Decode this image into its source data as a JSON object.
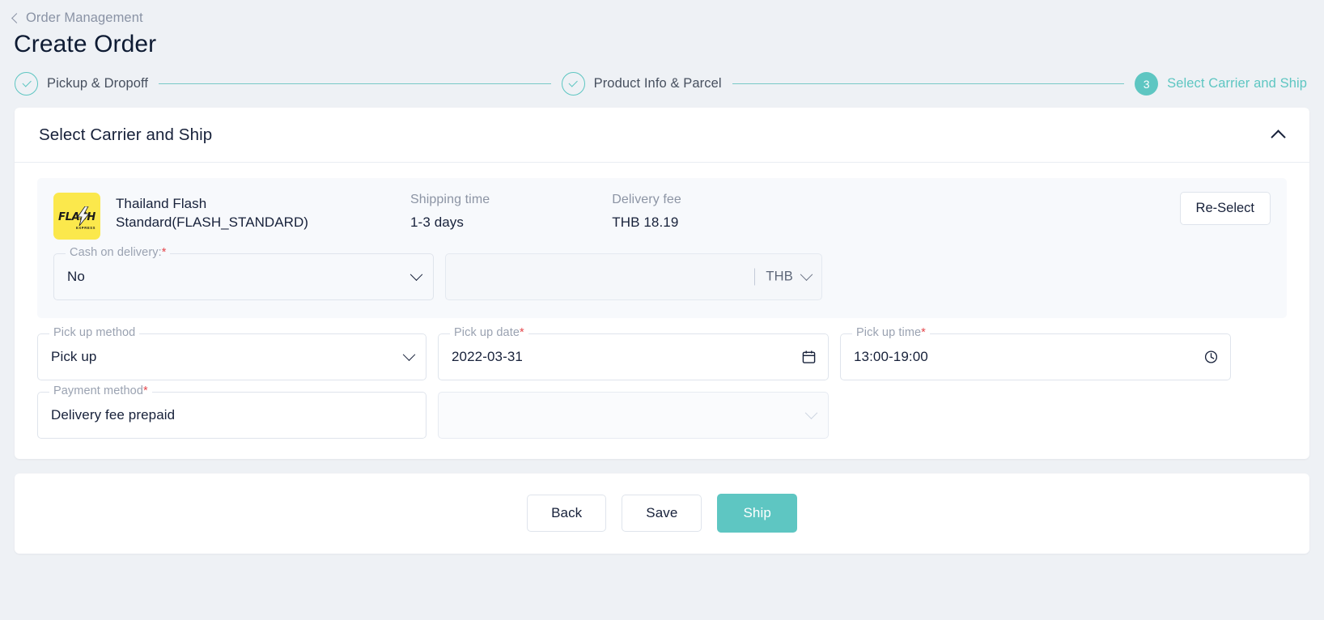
{
  "header": {
    "breadcrumb": "Order Management",
    "back_icon": "chevron-left-icon",
    "title": "Create Order"
  },
  "stepper": {
    "steps": [
      {
        "label": "Pickup & Dropoff",
        "state": "done",
        "marker": "check-icon"
      },
      {
        "label": "Product Info & Parcel",
        "state": "done",
        "marker": "check-icon"
      },
      {
        "label": "Select Carrier and Ship",
        "state": "active",
        "marker": "3"
      }
    ],
    "active_color": "#5ec6c2",
    "line_color": "#79c9c7"
  },
  "section": {
    "title": "Select Carrier and Ship",
    "collapse_icon": "chevron-up-icon"
  },
  "carrier": {
    "logo_text": "FLASH",
    "logo_sub": "EXPRESS",
    "logo_bg": "#fbe84c",
    "name": "Thailand Flash Standard(FLASH_STANDARD)",
    "shipping_time_label": "Shipping time",
    "shipping_time_value": "1-3 days",
    "delivery_fee_label": "Delivery fee",
    "delivery_fee_value": "THB 18.19",
    "reselect_label": "Re-Select"
  },
  "fields": {
    "cash_on_delivery": {
      "label": "Cash on delivery:",
      "required": "*",
      "value": "No",
      "icon": "chevron-down-icon"
    },
    "cod_amount": {
      "label": "",
      "value": "",
      "placeholder": "",
      "currency": "THB",
      "currency_icon": "chevron-down-icon",
      "disabled": true
    },
    "pickup_method": {
      "label": "Pick up method",
      "required": "",
      "value": "Pick up",
      "icon": "chevron-down-icon"
    },
    "pickup_date": {
      "label": "Pick up date",
      "required": "*",
      "value": "2022-03-31",
      "icon": "calendar-icon"
    },
    "pickup_time": {
      "label": "Pick up time",
      "required": "*",
      "value": "13:00-19:00",
      "icon": "clock-icon"
    },
    "payment_method": {
      "label": "Payment method",
      "required": "*",
      "value": "Delivery fee prepaid",
      "icon": ""
    },
    "payment_extra": {
      "label": "",
      "value": "",
      "icon": "chevron-down-icon",
      "disabled": true
    }
  },
  "footer": {
    "back_label": "Back",
    "save_label": "Save",
    "ship_label": "Ship",
    "ship_color": "#5ec6c2"
  }
}
